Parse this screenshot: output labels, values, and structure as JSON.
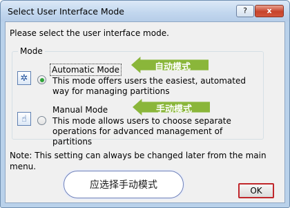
{
  "window": {
    "title": "Select User Interface Mode",
    "help_label": "?",
    "close_label": "x"
  },
  "instruction": "Please select the user interface mode.",
  "mode_group": {
    "label": "Mode",
    "options": [
      {
        "title": "Automatic Mode",
        "description": "This mode offers users the easiest, automated way for managing partitions",
        "selected": true,
        "icon": "automatic-mode-icon"
      },
      {
        "title": "Manual Mode",
        "description": "This mode allows users to choose separate operations for advanced management of partitions",
        "selected": false,
        "icon": "manual-mode-icon"
      }
    ]
  },
  "note": "Note: This setting can always be changed later from the main menu.",
  "ok_label": "OK",
  "annotations": {
    "automatic_label": "自动模式",
    "manual_label": "手动模式",
    "callout": "应选择手动模式"
  },
  "colors": {
    "arrow": "#8ab63a",
    "ok_highlight": "#c0262b",
    "radio_checked": "#2fa43a"
  }
}
